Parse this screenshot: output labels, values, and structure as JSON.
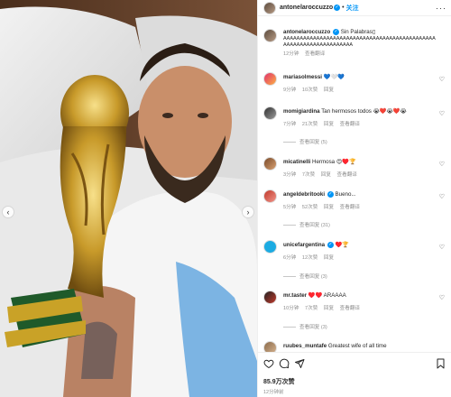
{
  "post": {
    "author": "antonelaroccuzzo",
    "follow_label": "关注",
    "more_label": "···",
    "caption_author": "antonelaroccuzzo",
    "caption_title": "Sin Palabras▯",
    "caption_text": "AAAAAAAAAAAAAAAAAAAAAAAAAAAAAAAAAAAAAAAAAAAAAAAAAAAAAAAAAAAAAAAAAAA",
    "caption_time": "12分钟",
    "caption_translate": "查看翻译",
    "likes": "85.9万次赞",
    "posted_ago": "12分钟前"
  },
  "comments": [
    {
      "user": "mariasolmessi",
      "text": "💙🤍💙",
      "time": "9分钟",
      "likes": "10次赞",
      "reply": "回复",
      "translate": "",
      "replies": ""
    },
    {
      "user": "momigiardina",
      "text": "Tan hermosos todos 😭❤️😭❤️😭",
      "time": "7分钟",
      "likes": "21次赞",
      "reply": "回复",
      "translate": "查看翻译",
      "replies": "查看回复 (5)"
    },
    {
      "user": "micatinelli",
      "text": "Hermosa 😍♥️🏆",
      "time": "3分钟",
      "likes": "7次赞",
      "reply": "回复",
      "translate": "查看翻译",
      "replies": ""
    },
    {
      "user": "angeldebritooki",
      "text": "Bueno...",
      "time": "5分钟",
      "likes": "52次赞",
      "reply": "回复",
      "translate": "查看翻译",
      "replies": "查看回复 (31)"
    },
    {
      "user": "unicefargentina",
      "text": "♥️🏆",
      "time": "6分钟",
      "likes": "12次赞",
      "reply": "回复",
      "translate": "",
      "replies": "查看回复 (3)"
    },
    {
      "user": "mr.taster",
      "text": "♥️♥️ ARAAAA",
      "time": "10分钟",
      "likes": "7次赞",
      "reply": "回复",
      "translate": "查看翻译",
      "replies": "查看回复 (3)"
    },
    {
      "user": "ruubes_muntafe",
      "text": "Greatest wife of all time",
      "time": "",
      "likes": "",
      "reply": "",
      "translate": "",
      "replies": ""
    }
  ],
  "icons": {
    "heart": "heart-icon",
    "comment": "comment-icon",
    "share": "share-icon",
    "save": "bookmark-icon",
    "verified": "verified-badge-icon",
    "nav_left": "chevron-left-icon",
    "nav_right": "chevron-right-icon"
  },
  "colors": {
    "link": "#0095f6",
    "muted": "#8e8e8e",
    "text": "#262626"
  }
}
